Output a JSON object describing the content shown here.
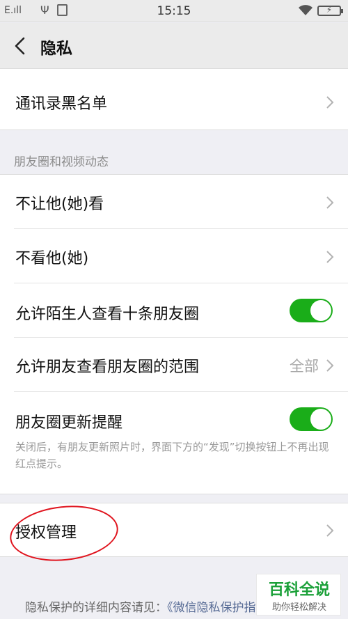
{
  "status_bar": {
    "carrier": "E.ıll",
    "usb_icon": "usb-icon",
    "time": "15:15",
    "wifi_icon": "wifi-icon",
    "battery_icon": "battery-charging-icon"
  },
  "nav": {
    "back_icon": "chevron-left-icon",
    "title": "隐私"
  },
  "blacklist": {
    "label": "通讯录黑名单"
  },
  "moments_section": {
    "header": "朋友圈和视频动态",
    "items": [
      {
        "label": "不让他(她)看"
      },
      {
        "label": "不看他(她)"
      },
      {
        "label": "允许陌生人查看十条朋友圈",
        "toggle": true
      },
      {
        "label": "允许朋友查看朋友圈的范围",
        "value": "全部"
      },
      {
        "label": "朋友圈更新提醒",
        "toggle": true
      }
    ],
    "hint": "关闭后，有朋友更新照片时，界面下方的“发现”切换按钮上不再出现红点提示。"
  },
  "authorization": {
    "label": "授权管理"
  },
  "footer": {
    "text": "隐私保护的详细内容请见：",
    "link": "《微信隐私保护指引》"
  },
  "watermark": {
    "title": "百科全说",
    "subtitle": "助你轻松解决"
  },
  "colors": {
    "toggle_on": "#1aad19",
    "link": "#576b95",
    "annotation_circle": "#e0141e"
  }
}
